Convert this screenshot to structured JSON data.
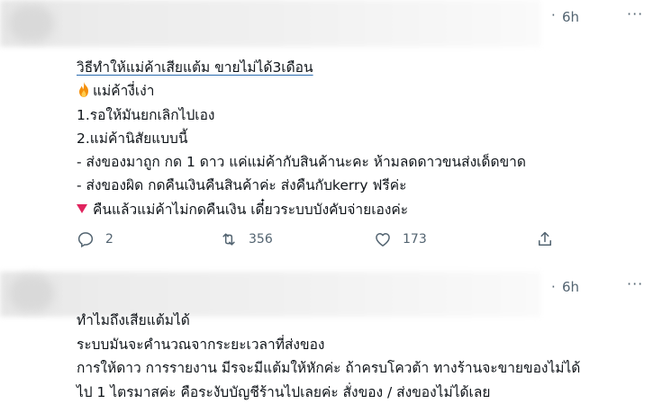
{
  "tweets": [
    {
      "dot": "·",
      "time": "6h",
      "more": "···",
      "lines": [
        "วิธีทำให้แม่ค้าเสียแต้ม ขายไม่ได้3เดือน",
        "แม่ค้างี่เง่า",
        "1.รอให้มันยกเลิกไปเอง",
        "2.แม่ค้านิสัยแบบนี้",
        "- ส่งของมาถูก กด 1 ดาว แค่แม่ค้ากับสินค้านะคะ ห้ามลดดาวขนส่งเด็ดขาด",
        "- ส่งของผิด กดคืนเงินคืนสินค้าค่ะ ส่งคืนกับkerry ฟรีค่ะ",
        "คืนแล้วแม่ค้าไม่กดคืนเงิน เดี๋ยวระบบบังคับจ่ายเองค่ะ"
      ],
      "icons": {
        "fire": "fire-icon",
        "triangle": "red-triangle-down-icon"
      },
      "actions": {
        "reply_count": "2",
        "retweet_count": "356",
        "like_count": "173"
      }
    },
    {
      "dot": "·",
      "time": "6h",
      "more": "···",
      "lines": [
        "ทำไมถึงเสียแต้มได้",
        "ระบบมันจะคำนวณจากระยะเวลาที่ส่งของ",
        "การให้ดาว การรายงาน มีรจะมีแต้มให้หักค่ะ ถ้าครบโควต้า ทางร้านจะขายของไม่ได้",
        "ไป 1 ไตรมาสค่ะ คือระงับบัญชีร้านไปเลยค่ะ สั่งของ / ส่งของไม่ได้เลย"
      ]
    }
  ],
  "colors": {
    "text": "#0f1419",
    "muted": "#536471",
    "triangle": "#e0245e",
    "fire": "#f4900c"
  }
}
